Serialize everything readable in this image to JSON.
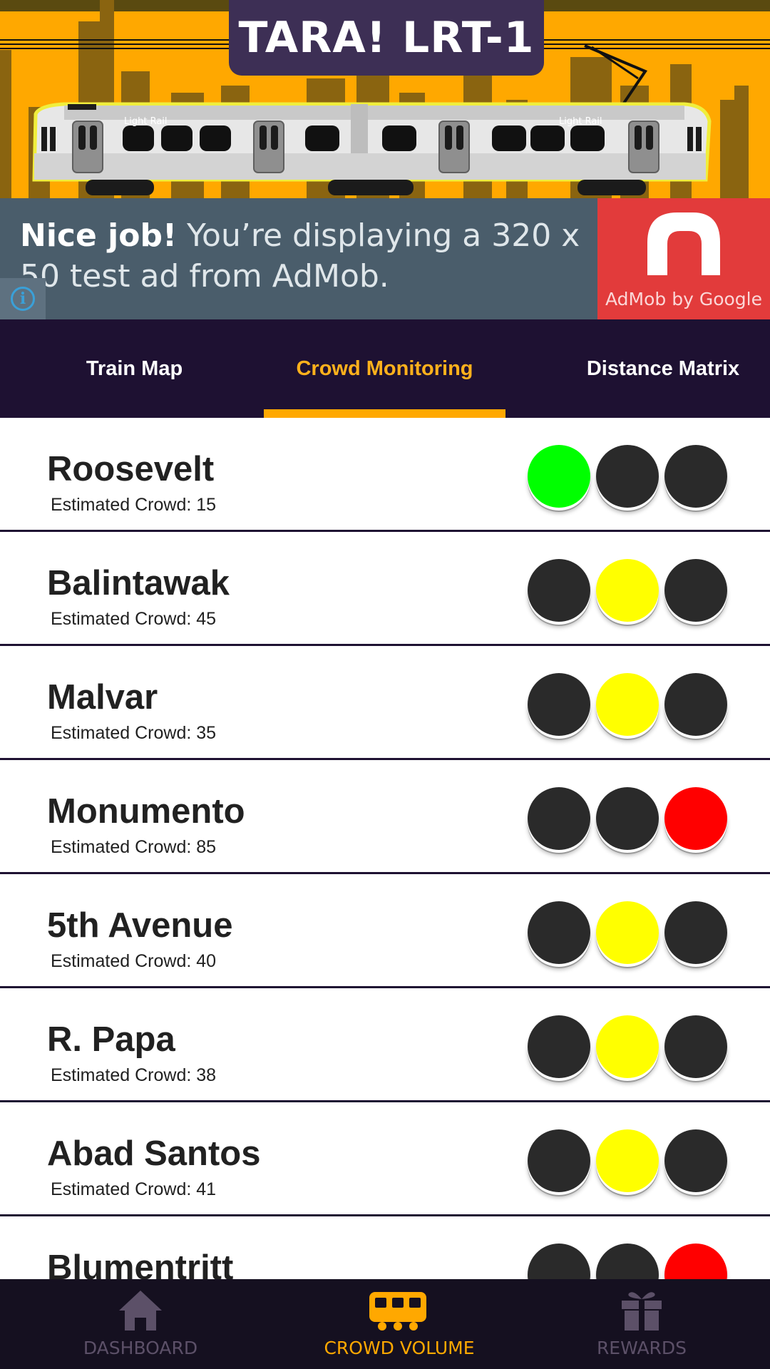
{
  "header": {
    "title": "TARA! LRT-1",
    "train_text_left": "Light Rail",
    "train_text_right": "Light Rail"
  },
  "ad": {
    "headline_bold": "Nice job!",
    "headline_rest": " You’re displaying a 320 x 50 test ad from AdMob.",
    "brand_label": "AdMob by Google",
    "info_glyph": "i"
  },
  "tabs": {
    "items": [
      {
        "label": "Train Map"
      },
      {
        "label": "Crowd Monitoring"
      },
      {
        "label": "Distance Matrix"
      }
    ],
    "active_index": 1
  },
  "crowd_label": "Estimated Crowd: ",
  "stations": [
    {
      "name": "Roosevelt",
      "crowd": "15",
      "lights": [
        "green",
        "off",
        "off"
      ]
    },
    {
      "name": "Balintawak",
      "crowd": "45",
      "lights": [
        "off",
        "yellow",
        "off"
      ]
    },
    {
      "name": "Malvar",
      "crowd": "35",
      "lights": [
        "off",
        "yellow",
        "off"
      ]
    },
    {
      "name": "Monumento",
      "crowd": "85",
      "lights": [
        "off",
        "off",
        "red"
      ]
    },
    {
      "name": "5th Avenue",
      "crowd": "40",
      "lights": [
        "off",
        "yellow",
        "off"
      ]
    },
    {
      "name": "R. Papa",
      "crowd": "38",
      "lights": [
        "off",
        "yellow",
        "off"
      ]
    },
    {
      "name": "Abad Santos",
      "crowd": "41",
      "lights": [
        "off",
        "yellow",
        "off"
      ]
    },
    {
      "name": "Blumentritt",
      "crowd": "",
      "lights": [
        "off",
        "off",
        "red"
      ]
    }
  ],
  "bottom_nav": {
    "items": [
      {
        "label": "DASHBOARD",
        "icon": "home-icon"
      },
      {
        "label": "CROWD VOLUME",
        "icon": "train-icon"
      },
      {
        "label": "REWARDS",
        "icon": "gift-icon"
      }
    ],
    "active_index": 1
  },
  "colors": {
    "accent": "#ffa800",
    "nav_dark": "#1e1132",
    "light_green": "#00ff00",
    "light_yellow": "#ffff00",
    "light_red": "#ff0000",
    "light_off": "#2a2a2a"
  }
}
